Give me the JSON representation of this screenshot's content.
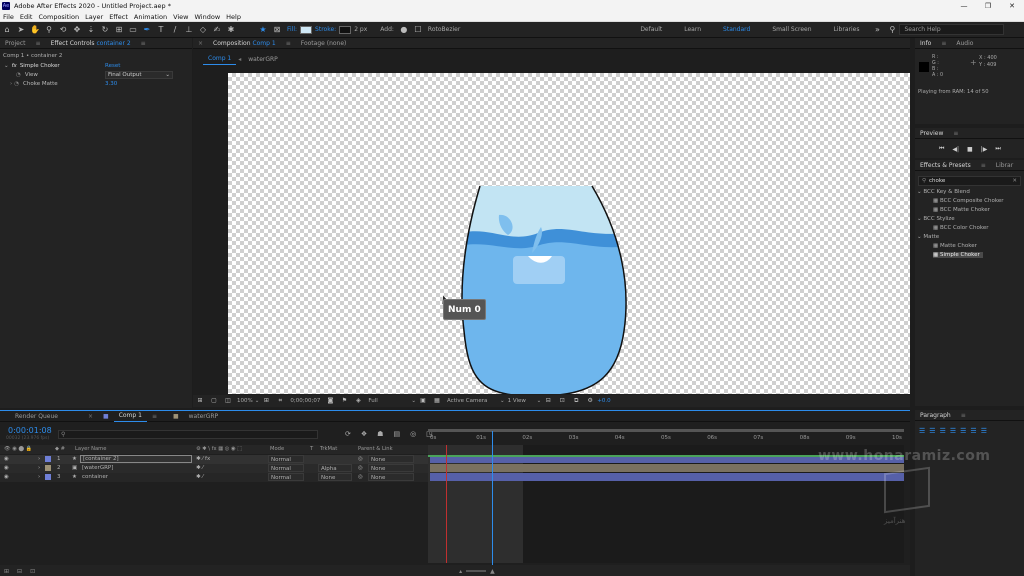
{
  "window": {
    "title": "Adobe After Effects 2020 - Untitled Project.aep *",
    "app_icon": "Ae",
    "buttons": [
      "—",
      "❐",
      "✕"
    ]
  },
  "menu": [
    "File",
    "Edit",
    "Composition",
    "Layer",
    "Effect",
    "Animation",
    "View",
    "Window",
    "Help"
  ],
  "toolbar": {
    "fill_label": "Fill:",
    "stroke_label": "Stroke:",
    "stroke_width": "2 px",
    "add_label": "Add:",
    "rotobezier_label": "RotoBezier",
    "workspaces": [
      "Default",
      "Learn",
      "Standard",
      "Small Screen",
      "Libraries"
    ],
    "active_workspace": "Standard",
    "search_placeholder": "Search Help"
  },
  "left_panel": {
    "tabs": [
      "Project",
      "Effect Controls"
    ],
    "effect_controls_layer": "container 2",
    "breadcrumb": "Comp 1 • container 2",
    "effect_name": "Simple Choker",
    "reset_label": "Reset",
    "view_label": "View",
    "view_value": "Final Output",
    "choke_label": "Choke Matte",
    "choke_value": "3.30"
  },
  "comp_panel": {
    "tab_label": "Composition",
    "tab_comp": "Comp 1",
    "footage_tab": "Footage (none)",
    "breadcrumbs": [
      "Comp 1",
      "waterGRP"
    ],
    "tooltip": "Num 0",
    "footer": {
      "zoom": "100%",
      "timecode": "0;00;00;07",
      "resolution": "Full",
      "camera": "Active Camera",
      "views": "1 View",
      "exposure": "+0.0"
    }
  },
  "info_panel": {
    "tabs": [
      "Info",
      "Audio"
    ],
    "rgba_labels": [
      "R :",
      "G :",
      "B :",
      "A : 0"
    ],
    "x": "X : 400",
    "y": "Y : 409",
    "status": "Playing from RAM: 14 of 50"
  },
  "preview_panel": {
    "title": "Preview"
  },
  "effects_panel": {
    "tabs": [
      "Effects & Presets",
      "Librar"
    ],
    "search_value": "choke",
    "items": [
      {
        "label": "BCC Key & Blend",
        "type": "category"
      },
      {
        "label": "BCC Composite Choker",
        "type": "effect"
      },
      {
        "label": "BCC Matte Choker",
        "type": "effect"
      },
      {
        "label": "BCC Stylize",
        "type": "category"
      },
      {
        "label": "BCC Color Choker",
        "type": "effect"
      },
      {
        "label": "Matte",
        "type": "category"
      },
      {
        "label": "Matte Choker",
        "type": "effect"
      },
      {
        "label": "Simple Choker",
        "type": "effect",
        "selected": true
      }
    ]
  },
  "paragraph_panel": {
    "title": "Paragraph"
  },
  "timeline": {
    "tabs": [
      "Render Queue",
      "Comp 1",
      "waterGRP"
    ],
    "timecode": "0:00:01:08",
    "fps_note": "00032 (23.976 fps)",
    "headers": {
      "layer_name": "Layer Name",
      "mode": "Mode",
      "t": "T",
      "trkmat": "TrkMat",
      "parent": "Parent & Link"
    },
    "layers": [
      {
        "num": "1",
        "name": "[container 2]",
        "mode": "Normal",
        "trkmat": "",
        "parent": "None",
        "color": "#6f7fd6",
        "icon": "★"
      },
      {
        "num": "2",
        "name": "[waterGRP]",
        "mode": "Normal",
        "trkmat": "Alpha",
        "parent": "None",
        "color": "#9e9276",
        "icon": "▣"
      },
      {
        "num": "3",
        "name": "container",
        "mode": "Normal",
        "trkmat": "None",
        "parent": "None",
        "color": "#6f7fd6",
        "icon": "★"
      }
    ],
    "ruler": [
      "0s",
      "01s",
      "02s",
      "03s",
      "04s",
      "05s",
      "06s",
      "07s",
      "08s",
      "09s",
      "10s"
    ],
    "playhead_fraction": 0.135,
    "work_area_end_fraction": 0.205
  },
  "watermark": {
    "url": "www.honaramiz.com",
    "logo_text": "هنرآمیز"
  },
  "colors": {
    "accent": "#2d8ceb",
    "water_light": "#bfe3f2",
    "water_mid": "#3e8fd8",
    "water_body": "#6fb8ee"
  }
}
